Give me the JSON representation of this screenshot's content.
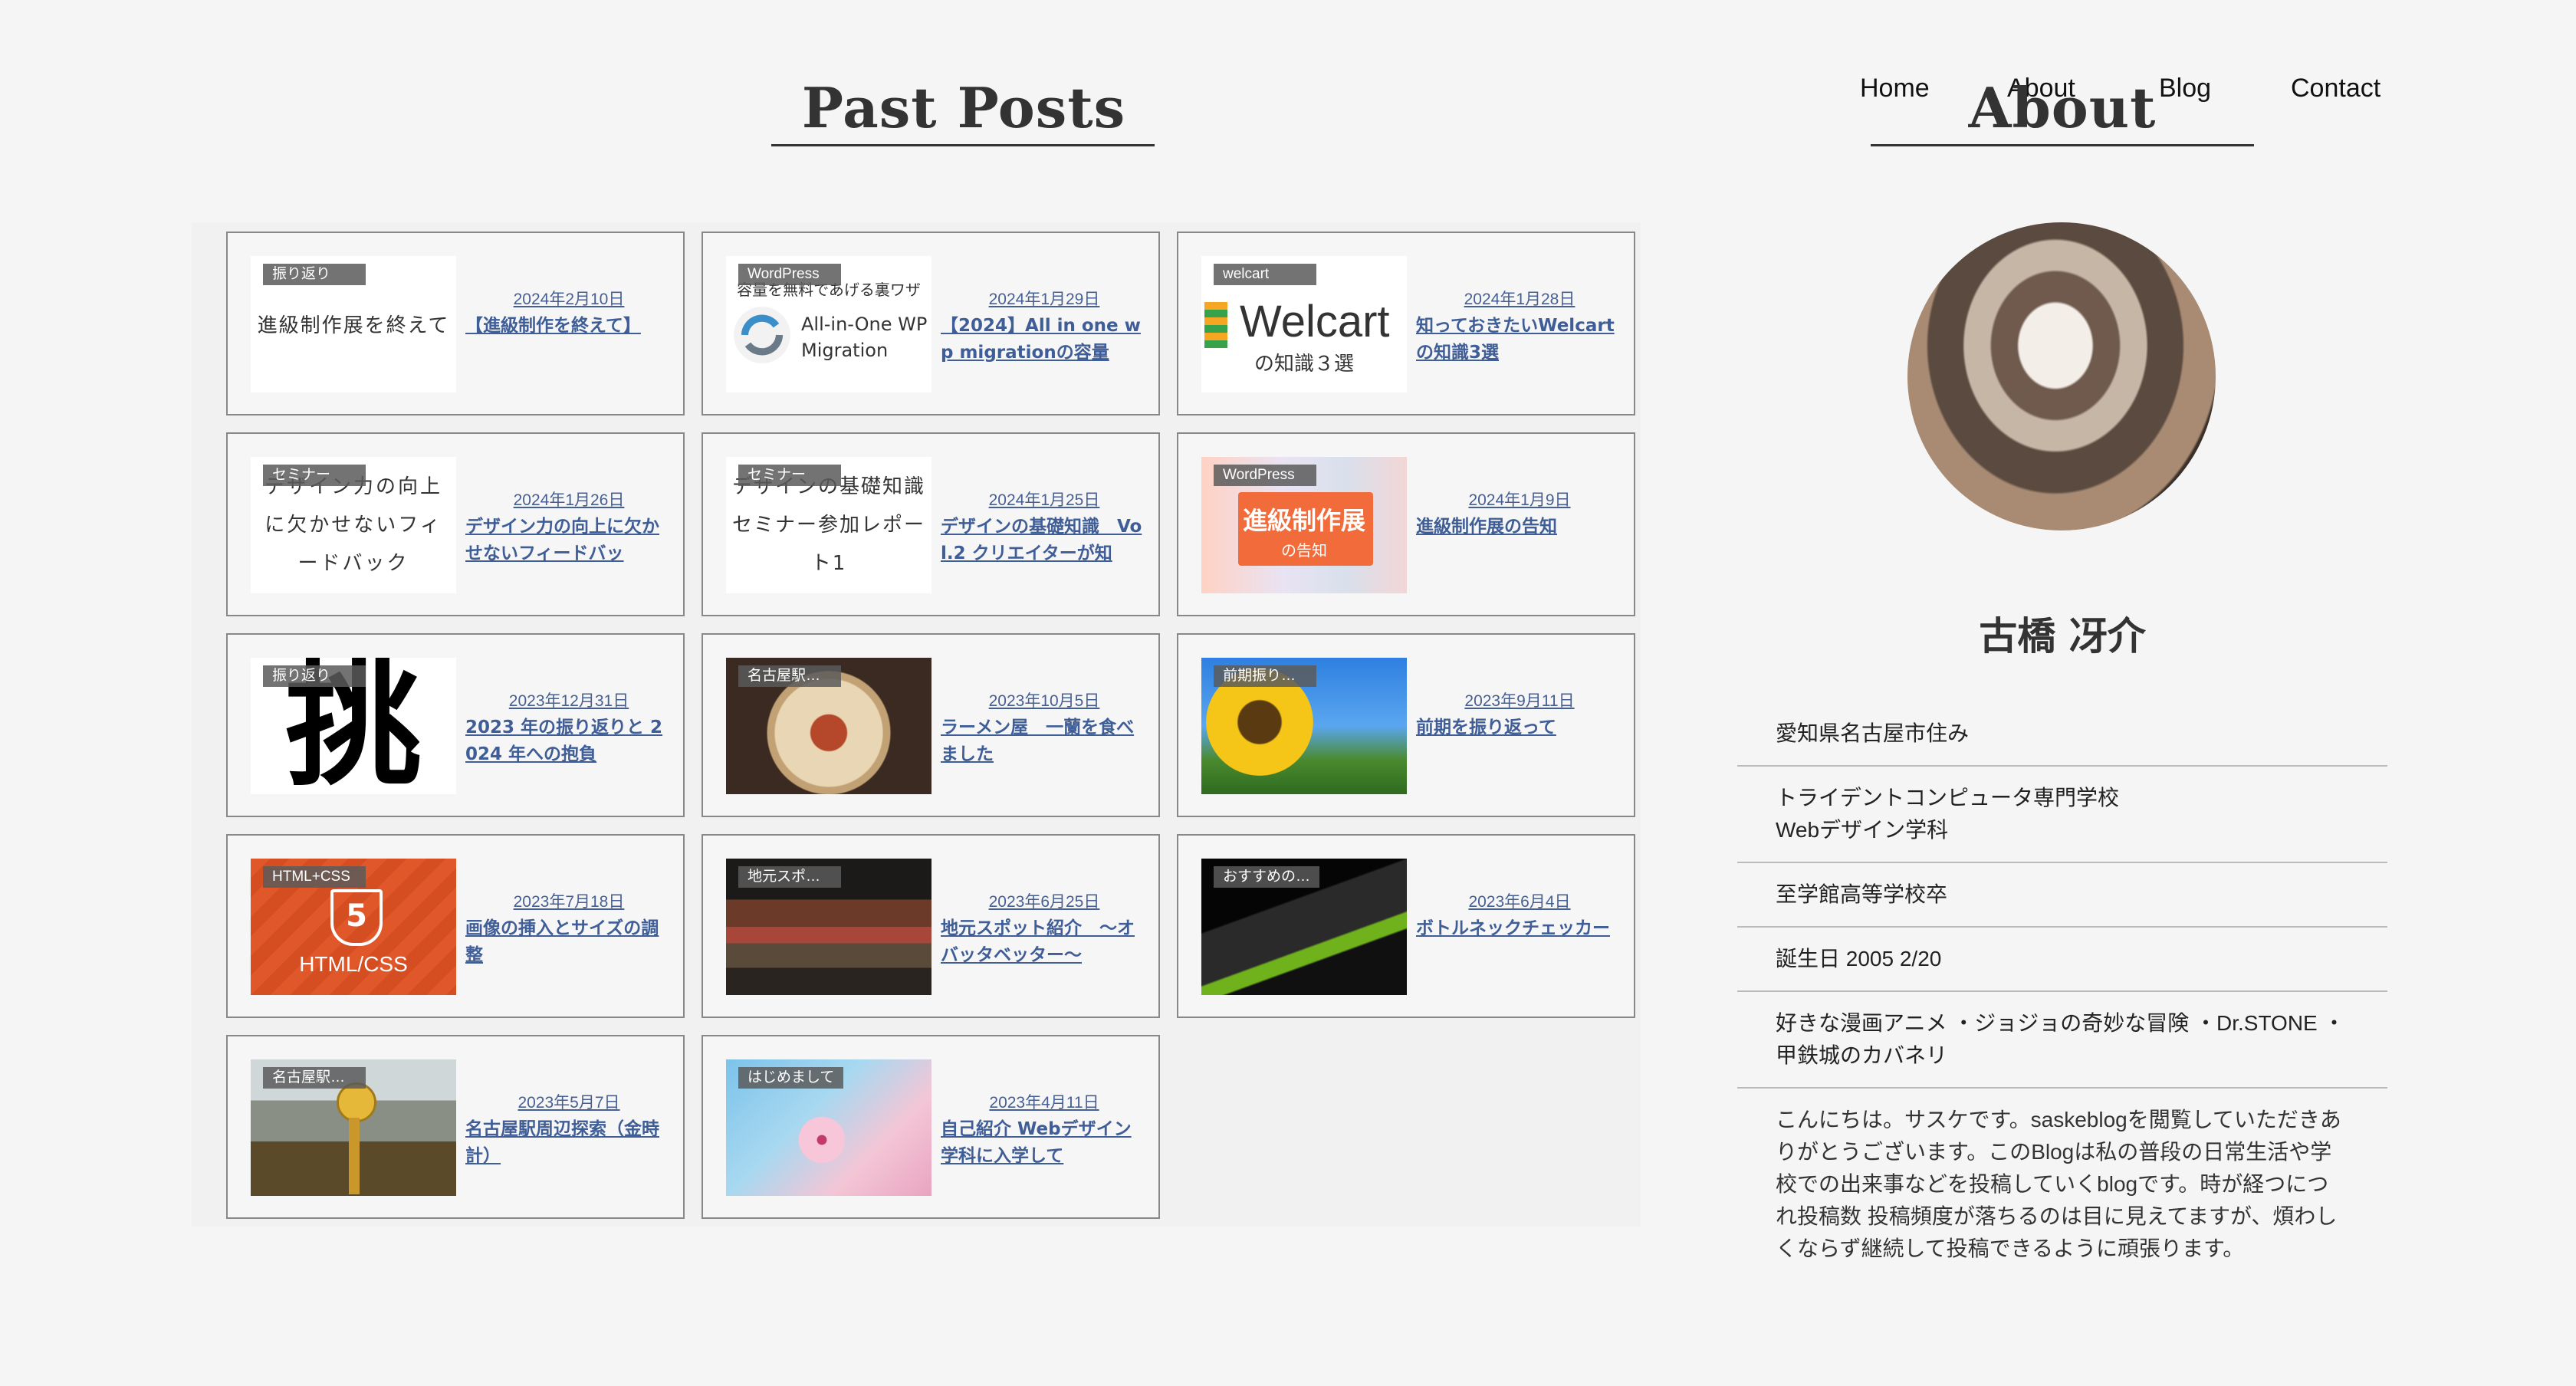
{
  "nav": {
    "home": "Home",
    "about": "About",
    "blog": "Blog",
    "contact": "Contact"
  },
  "past_posts": {
    "heading": "Past Posts"
  },
  "about": {
    "heading": "About",
    "name": "古橋 冴介"
  },
  "posts": [
    {
      "badge": "振り返り",
      "thumb_text": "進級制作展を終えて",
      "date": "2024年2月10日",
      "title": "【進級制作を終えて】"
    },
    {
      "badge": "WordPress",
      "thumb_text": "容量を無料であげる裏ワザ",
      "thumb_text2": "All-in-One WP Migration",
      "date": "2024年1月29日",
      "title": "【2024】All in one wp migrationの容量"
    },
    {
      "badge": "welcart",
      "thumb_text": "Welcart",
      "thumb_text2": "の知識３選",
      "date": "2024年1月28日",
      "title": "知っておきたいWelcartの知識3選"
    },
    {
      "badge": "セミナー",
      "thumb_text": "デザイン力の向上に欠かせないフィードバック",
      "date": "2024年1月26日",
      "title": "デザイン力の向上に欠かせないフィードバッ"
    },
    {
      "badge": "セミナー",
      "thumb_text": "デザインの基礎知識 セミナー参加レポート1",
      "date": "2024年1月25日",
      "title": "デザインの基礎知識　Vol.2 クリエイターが知"
    },
    {
      "badge": "WordPress",
      "thumb_text": "進級制作展",
      "thumb_text2": "の告知",
      "date": "2024年1月9日",
      "title": "進級制作展の告知"
    },
    {
      "badge": "振り返り",
      "thumb_text": "挑",
      "date": "2023年12月31日",
      "title": "2023 年の振り返りと 2024 年への抱負"
    },
    {
      "badge": "名古屋駅…",
      "date": "2023年10月5日",
      "title": "ラーメン屋　一蘭を食べました"
    },
    {
      "badge": "前期振り…",
      "date": "2023年9月11日",
      "title": "前期を振り返って"
    },
    {
      "badge": "HTML+CSS",
      "thumb_text": "HTML/CSS",
      "date": "2023年7月18日",
      "title": "画像の挿入とサイズの調整"
    },
    {
      "badge": "地元スポ…",
      "date": "2023年6月25日",
      "title": "地元スポット紹介　〜オバッタベッター〜"
    },
    {
      "badge": "おすすめの…",
      "date": "2023年6月4日",
      "title": "ボトルネックチェッカー"
    },
    {
      "badge": "名古屋駅…",
      "date": "2023年5月7日",
      "title": "名古屋駅周辺探索（金時計）"
    },
    {
      "badge": "はじめまして",
      "date": "2023年4月11日",
      "title": "自己紹介 Webデザイン学科に入学して"
    }
  ],
  "profile": {
    "location": "愛知県名古屋市住み",
    "school": "トライデントコンピュータ専門学校",
    "department": "Webデザイン学科",
    "high_school": "至学館高等学校卒",
    "birthday": "誕生日 2005 2/20",
    "favorites": "好きな漫画アニメ ・ジョジョの奇妙な冒険 ・Dr.STONE ・甲鉄城のカバネリ",
    "intro": "こんにちは。サスケです。saskeblogを閲覧していただきありがとうございます。このBlogは私の普段の日常生活や学校での出来事などを投稿していくblogです。時が経つにつれ投稿数 投稿頻度が落ちるのは目に見えてますが、煩わしくならず継続して投稿できるように頑張ります。"
  },
  "colors": {
    "link": "#3f5d97",
    "rule": "#333333",
    "card_border": "#888888",
    "badge_bg": "#5a5a5a"
  }
}
